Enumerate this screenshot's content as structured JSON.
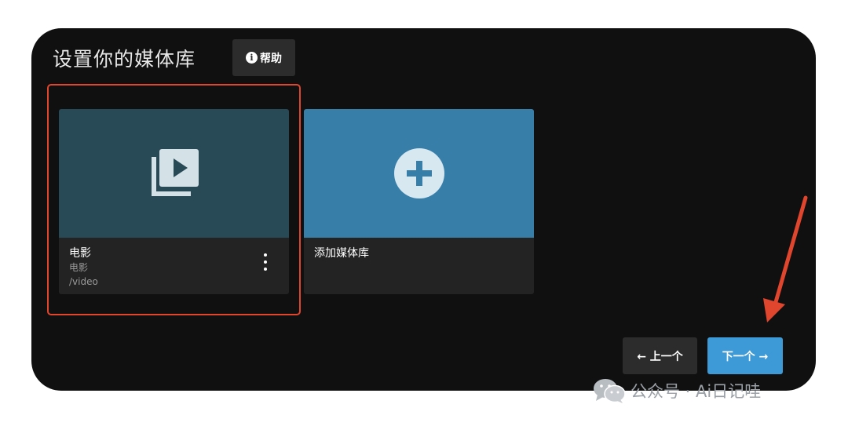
{
  "page_title": "设置你的媒体库",
  "help_button": {
    "icon": "info-icon",
    "icon_glyph": "i",
    "label": "帮助"
  },
  "libraries": [
    {
      "title": "电影",
      "type": "电影",
      "path": "/video",
      "icon": "video-library-icon",
      "color": "#284956"
    }
  ],
  "add_library": {
    "label": "添加媒体库",
    "icon": "plus-circle-icon",
    "color": "#377ea8"
  },
  "nav": {
    "prev_label": "← 上一个",
    "next_label": "下一个 →"
  },
  "watermark": {
    "text": "公众号 · Ai日记哇",
    "icon": "wechat-icon"
  },
  "colors": {
    "background": "#101010",
    "highlight": "#e0452e",
    "accent": "#3d9ad6",
    "arrow": "#e0452e"
  }
}
